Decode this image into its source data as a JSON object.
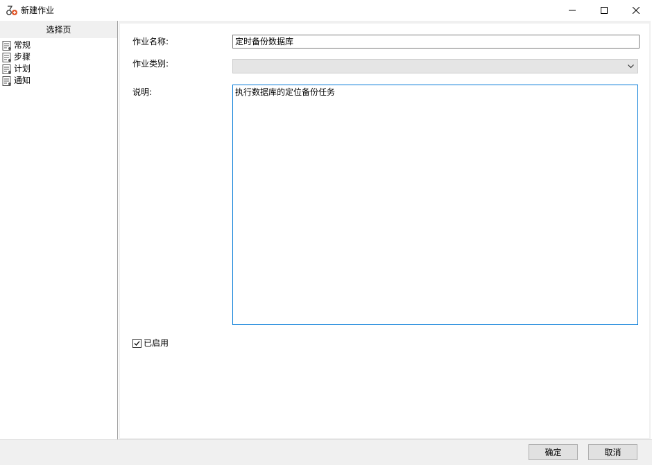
{
  "window": {
    "title": "新建作业"
  },
  "left_panel": {
    "header": "选择页",
    "items": [
      {
        "label": "常规"
      },
      {
        "label": "步骤"
      },
      {
        "label": "计划"
      },
      {
        "label": "通知"
      }
    ]
  },
  "form": {
    "name_label": "作业名称:",
    "name_value": "定时备份数据库",
    "category_label": "作业类别:",
    "category_value": "",
    "description_label": "说明:",
    "description_value": "执行数据库的定位备份任务",
    "enabled_label": "已启用",
    "enabled_checked": true
  },
  "buttons": {
    "ok_label": "确定",
    "cancel_label": "取消"
  },
  "colors": {
    "focus_border": "#0078d7",
    "panel_bg": "#f0f0f0",
    "app_icon_accent": "#e0572a"
  },
  "icons": {
    "app": "job-icon",
    "page_item": "page-icon",
    "minimize": "minimize-icon",
    "maximize": "maximize-icon",
    "close": "close-icon",
    "dropdown": "chevron-down-icon",
    "check": "checkmark-icon"
  }
}
